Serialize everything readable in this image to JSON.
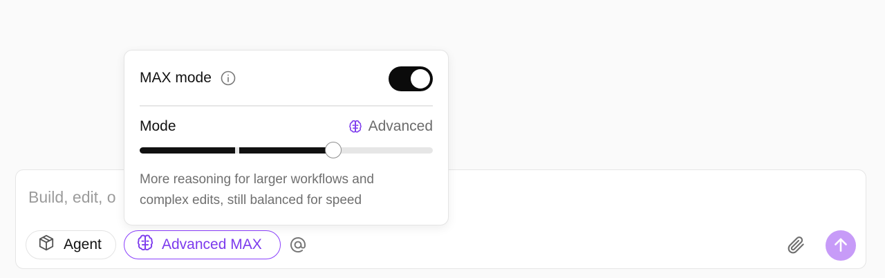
{
  "composer": {
    "placeholder": "Build, edit, o",
    "agent_label": "Agent",
    "max_label": "Advanced MAX",
    "at_icon": "at-sign-icon",
    "attach_icon": "paperclip-icon",
    "send_icon": "arrow-up-icon"
  },
  "popover": {
    "max_mode_label": "MAX mode",
    "max_mode_enabled": true,
    "mode_label": "Mode",
    "mode_value": "Advanced",
    "slider_levels": 3,
    "slider_value_fraction": 0.66,
    "description_line1": "More reasoning for larger workflows and",
    "description_line2": "complex edits, still balanced for speed"
  },
  "colors": {
    "accent": "#7c3aed",
    "accent_border": "#8a3ffc",
    "send_button": "#c79bf8",
    "toggle_on": "#0b0b0b"
  }
}
